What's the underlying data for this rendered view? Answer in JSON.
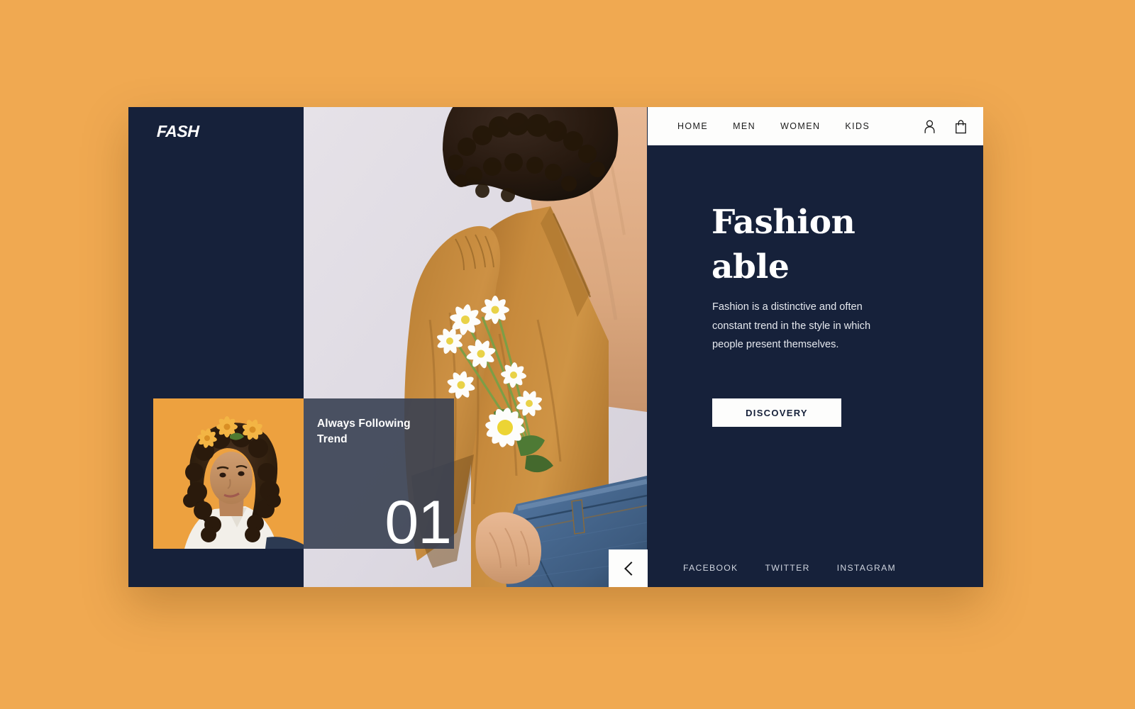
{
  "brand": {
    "logo_text": "FASH"
  },
  "nav": {
    "links": [
      {
        "label": "HOME"
      },
      {
        "label": "MEN"
      },
      {
        "label": "WOMEN"
      },
      {
        "label": "KIDS"
      }
    ],
    "icons": [
      {
        "name": "user-account-icon"
      },
      {
        "name": "shopping-bag-icon"
      }
    ]
  },
  "hero": {
    "headline_line1": "Fashion",
    "headline_line2": "able",
    "paragraph": "Fashion is a distinctive and often constant trend in the style in which people present themselves.",
    "cta_label": "DISCOVERY"
  },
  "slide_card": {
    "title": "Always Following Trend",
    "number": "01"
  },
  "carousel": {
    "prev_label": "previous-slide",
    "next_label": "next-slide"
  },
  "socials": [
    {
      "label": "FACEBOOK"
    },
    {
      "label": "TWITTER"
    },
    {
      "label": "INSTAGRAM"
    }
  ],
  "colors": {
    "page_background": "#f0a951",
    "card_dark": "#16213a",
    "panel_white": "#fdfdfc",
    "caption_overlay": "#384052",
    "blouse_ochre": "#c98a3c",
    "denim_blue": "#4a6d99",
    "photo_backdrop": "#e2dfe6",
    "thumb_orange": "#eda13f"
  }
}
